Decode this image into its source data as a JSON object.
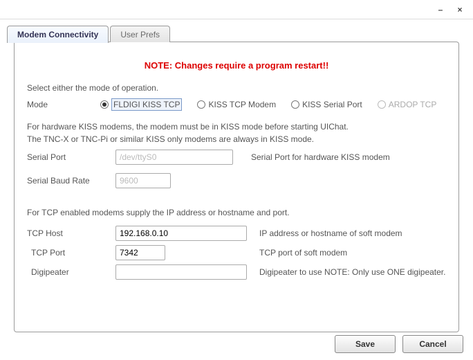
{
  "tabs": {
    "active": "Modem Connectivity",
    "other": "User Prefs"
  },
  "notice": "NOTE: Changes require a program restart!!",
  "instr": "Select either the mode of operation.",
  "mode": {
    "label": "Mode",
    "options": {
      "fldigi": "FLDIGI KISS TCP",
      "kisstcp": "KISS TCP Modem",
      "kissserial": "KISS Serial Port",
      "ardop": "ARDOP TCP"
    }
  },
  "hw_note1": "For hardware KISS modems, the modem must be in KISS mode before starting UIChat.",
  "hw_note2": "The TNC-X or TNC-Pi or similar KISS only modems are always in KISS mode.",
  "serial": {
    "port_label": "Serial Port",
    "port_value": "/dev/ttyS0",
    "port_hint": "Serial Port for hardware KISS modem",
    "baud_label": "Serial Baud Rate",
    "baud_value": "9600"
  },
  "tcp_note": "For TCP enabled modems supply the IP address or hostname and port.",
  "tcp": {
    "host_label": "TCP Host",
    "host_value": "192.168.0.10",
    "host_hint": "IP address or hostname of soft modem",
    "port_label": "TCP Port",
    "port_value": "7342",
    "port_hint": "TCP port of soft modem",
    "digi_label": "Digipeater",
    "digi_value": "",
    "digi_hint": "Digipeater to use NOTE: Only use ONE digipeater."
  },
  "buttons": {
    "save": "Save",
    "cancel": "Cancel"
  }
}
